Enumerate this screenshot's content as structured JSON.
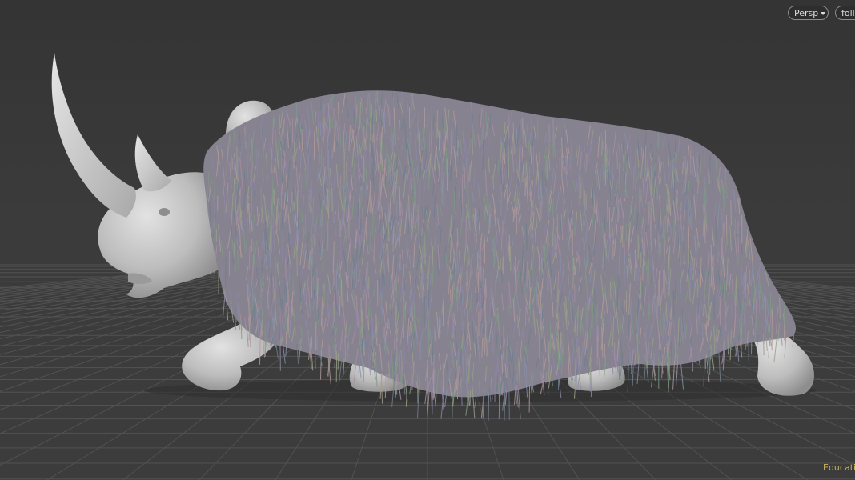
{
  "viewport": {
    "camera_menu_label": "Persp",
    "follow_menu_label": "follo",
    "license_watermark": "Educatio"
  },
  "scene": {
    "subject": "woolly-rhinoceros-model",
    "fur_colors": [
      "#8f86a6",
      "#7f9a86",
      "#a58fa0",
      "#9aa08a",
      "#8a8fa8",
      "#b09a9a",
      "#6f7f8f"
    ],
    "body_color": "#c9c9c9",
    "background_color": "#3a3a3a",
    "grid_color": "#555555"
  }
}
